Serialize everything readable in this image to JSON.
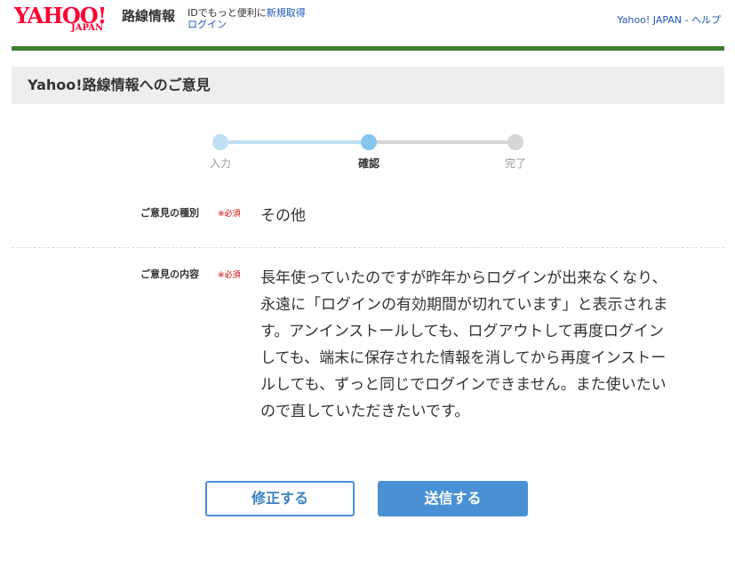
{
  "header": {
    "logo_text": "YAHOO!",
    "logo_sub": "JAPAN",
    "service_name": "路線情報",
    "id_promo_text": "IDでもっと便利に",
    "signup_link": "新規取得",
    "login_link": "ログイン",
    "help_link": "Yahoo! JAPAN - ヘルプ"
  },
  "page": {
    "title": "Yahoo!路線情報へのご意見"
  },
  "stepper": {
    "steps": [
      {
        "label": "入力",
        "state": "done"
      },
      {
        "label": "確認",
        "state": "current"
      },
      {
        "label": "完了",
        "state": "todo"
      }
    ]
  },
  "form": {
    "rows": [
      {
        "label": "ご意見の種別",
        "required": "※必須",
        "value": "その他"
      },
      {
        "label": "ご意見の内容",
        "required": "※必須",
        "value": "長年使っていたのですが昨年からログインが出来なくなり、\n永遠に「ログインの有効期間が切れています」と表示されま\nす。アンインストールしても、ログアウトして再度ログイン\nしても、端末に保存された情報を消してから再度インストー\nルしても、ずっと同じでログインできません。また使いたい\nので直していただきたいです。"
      }
    ]
  },
  "buttons": {
    "edit_label": "修正する",
    "send_label": "送信する"
  },
  "colors": {
    "brand_red": "#ff0033",
    "header_bar_green": "#3f7f2f",
    "link_blue": "#1a56b6",
    "primary_button": "#4a90d4",
    "required_red": "#cc0000"
  }
}
